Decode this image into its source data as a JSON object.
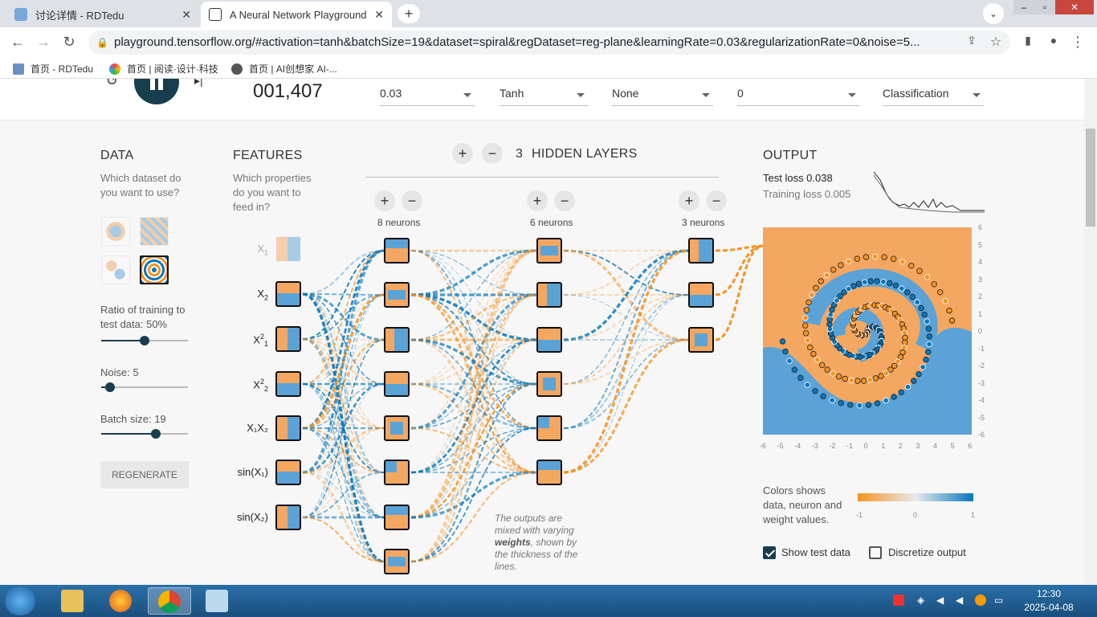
{
  "browser": {
    "tabs": [
      {
        "title": "讨论详情 - RDTedu",
        "active": false
      },
      {
        "title": "A Neural Network Playground",
        "active": true
      }
    ],
    "url": "playground.tensorflow.org/#activation=tanh&batchSize=19&dataset=spiral&regDataset=reg-plane&learningRate=0.03&regularizationRate=0&noise=5...",
    "bookmarks": [
      "首页 - RDTedu",
      "首页 | 阅读·设计·科技",
      "首页 | AI创想家 AI-..."
    ]
  },
  "controls": {
    "epoch": "001,407",
    "learning_rate": "0.03",
    "activation": "Tanh",
    "regularization": "None",
    "regularization_rate": "0",
    "problem_type": "Classification"
  },
  "data_panel": {
    "title": "DATA",
    "question": "Which dataset do you want to use?",
    "ratio_label": "Ratio of training to test data:  50%",
    "ratio_value": 0.5,
    "noise_label": "Noise:  5",
    "noise_value": 0.1,
    "batch_label": "Batch size:  19",
    "batch_value": 0.63,
    "regenerate": "REGENERATE"
  },
  "features_panel": {
    "title": "FEATURES",
    "question": "Which properties do you want to feed in?",
    "features": [
      {
        "label": "X",
        "sub": "1",
        "sup": "",
        "active": false
      },
      {
        "label": "X",
        "sub": "2",
        "sup": "",
        "active": true
      },
      {
        "label": "X",
        "sub": "1",
        "sup": "2",
        "active": true
      },
      {
        "label": "X",
        "sub": "2",
        "sup": "2",
        "active": true
      },
      {
        "label": "X₁X₂",
        "sub": "",
        "sup": "",
        "active": true
      },
      {
        "label": "sin(X₁)",
        "sub": "",
        "sup": "",
        "active": true
      },
      {
        "label": "sin(X₂)",
        "sub": "",
        "sup": "",
        "active": true
      }
    ]
  },
  "network": {
    "hidden_layers_count": "3",
    "hidden_layers_label": "HIDDEN LAYERS",
    "layers": [
      {
        "neurons_label": "8 neurons",
        "count": 8
      },
      {
        "neurons_label": "6 neurons",
        "count": 6
      },
      {
        "neurons_label": "3 neurons",
        "count": 3
      }
    ],
    "note_parts": [
      "The outputs are mixed with varying ",
      "weights",
      ", shown by the thickness of the lines."
    ]
  },
  "output_panel": {
    "title": "OUTPUT",
    "test_loss": "Test loss 0.038",
    "training_loss": "Training loss 0.005",
    "y_ticks": [
      "6",
      "5",
      "4",
      "3",
      "2",
      "1",
      "0",
      "-1",
      "-2",
      "-3",
      "-4",
      "-5",
      "-6"
    ],
    "x_ticks": [
      "-6",
      "-5",
      "-4",
      "-3",
      "-2",
      "-1",
      "0",
      "1",
      "2",
      "3",
      "4",
      "5",
      "6"
    ],
    "legend_text": "Colors shows data, neuron and weight values.",
    "legend_ticks": [
      "-1",
      "0",
      "1"
    ],
    "show_test_data": "Show test data",
    "show_test_checked": true,
    "discretize": "Discretize output",
    "discretize_checked": false
  },
  "colors": {
    "orange": "#f59322",
    "blue": "#0877bd",
    "dark": "#183d4e"
  },
  "taskbar": {
    "time": "12:30",
    "date": "2025-04-08"
  }
}
